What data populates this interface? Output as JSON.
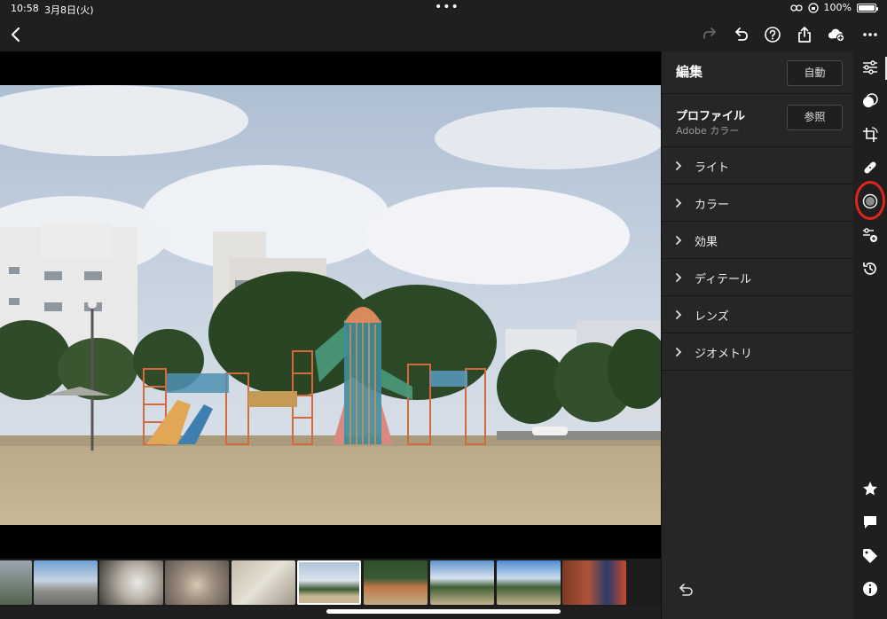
{
  "status_bar": {
    "time": "10:58",
    "date": "3月8日(火)",
    "center": "•••",
    "battery": "100%"
  },
  "toolbar": {
    "icons": [
      "back-icon",
      "redo-icon",
      "undo-icon",
      "help-icon",
      "share-icon",
      "cloud-add-icon",
      "more-icon"
    ]
  },
  "panel": {
    "title": "編集",
    "auto_label": "自動",
    "profile_label": "プロファイル",
    "profile_value": "Adobe カラー",
    "browse_label": "参照",
    "sections": [
      {
        "label": "ライト"
      },
      {
        "label": "カラー"
      },
      {
        "label": "効果"
      },
      {
        "label": "ディテール"
      },
      {
        "label": "レンズ"
      },
      {
        "label": "ジオメトリ"
      }
    ]
  },
  "rail": {
    "icons": [
      "edit-sliders-icon",
      "presets-icon",
      "crop-icon",
      "healing-icon",
      "masking-icon",
      "versions-icon",
      "history-icon",
      "rating-icon",
      "comment-icon",
      "tag-icon",
      "info-icon"
    ],
    "highlight_color": "#e0251b"
  },
  "filmstrip": {
    "selected_index": 4,
    "count": 10
  }
}
